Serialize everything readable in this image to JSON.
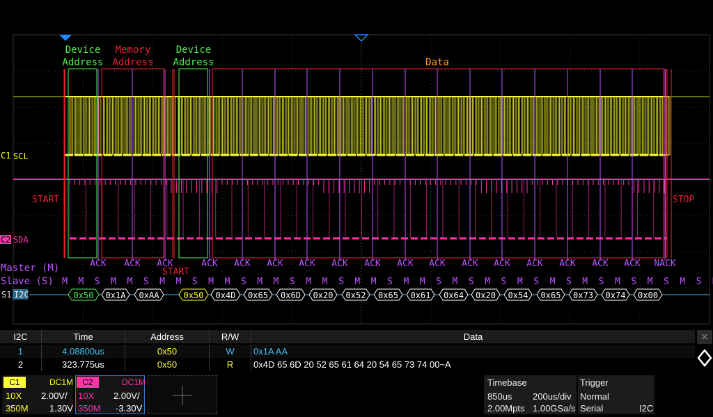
{
  "colors": {
    "ch1": "#ffff33",
    "ch2": "#ff33aa",
    "green": "#55ee55",
    "red": "#ee2233",
    "orange": "#ff9922",
    "purple": "#bb55ff",
    "bus": "#44bbee"
  },
  "scope": {
    "labels": {
      "device_address_1": [
        "Device",
        "Address"
      ],
      "memory_address": [
        "Memory",
        "Address"
      ],
      "device_address_2": [
        "Device",
        "Address"
      ],
      "data": "Data",
      "start": "START",
      "start2": "START",
      "stop": "STOP",
      "master": "Master (M)",
      "slave": "Slave (S)",
      "ch1": "C1",
      "ch1_name": "SCL",
      "ch2": "C2",
      "ch2_name": "SDA",
      "bus_id": "S1",
      "bus_name": "I2C"
    },
    "acks": [
      "ACK",
      "ACK",
      "ACK",
      "ACK",
      "ACK",
      "ACK",
      "ACK",
      "ACK",
      "ACK",
      "ACK",
      "ACK",
      "ACK",
      "ACK",
      "ACK",
      "ACK",
      "ACK",
      "ACK",
      "NACK"
    ],
    "ms_row": [
      "M",
      "M",
      "S",
      "M",
      "M",
      "S",
      "M",
      "M",
      "S",
      "M",
      "M",
      "S",
      "M",
      "M",
      "S",
      "M",
      "M",
      "S",
      "M",
      "M",
      "S",
      "M",
      "M",
      "S",
      "M",
      "S",
      "M",
      "S",
      "M",
      "S",
      "M",
      "S",
      "M",
      "S",
      "M",
      "S",
      "M",
      "S",
      "M",
      "S",
      "M",
      "S",
      "M",
      "S",
      "M",
      "S",
      "M",
      "S",
      "MM"
    ],
    "bytes": [
      "0x50",
      "0x1A",
      "0xAA",
      "0x50",
      "0x4D",
      "0x65",
      "0x6D",
      "0x20",
      "0x52",
      "0x65",
      "0x61",
      "0x64",
      "0x20",
      "0x54",
      "0x65",
      "0x73",
      "0x74",
      "0x00"
    ]
  },
  "table": {
    "headers": [
      "I2C",
      "Time",
      "Address",
      "R/W",
      "Data"
    ],
    "rows": [
      {
        "index": "1",
        "time": "4.08800us",
        "address": "0x50",
        "rw": "W",
        "data": "0x1A AA"
      },
      {
        "index": "2",
        "time": "323.775us",
        "address": "0x50",
        "rw": "R",
        "data": "0x4D 65 6D 20 52 65 61 64 20 54 65 73 74 00~A"
      }
    ],
    "close_icon": "close-icon",
    "nav_icon": "diamond-nav-icon"
  },
  "channels": {
    "c1": {
      "label": "C1",
      "coupling": "DC1M",
      "probe": "10X",
      "scale": "2.00V/",
      "bandwidth": "350M",
      "offset": "1.30V"
    },
    "c2": {
      "label": "C2",
      "coupling": "DC1M",
      "probe": "10X",
      "scale": "2.00V/",
      "bandwidth": "350M",
      "offset": "-3.30V"
    }
  },
  "timebase": {
    "title": "Timebase",
    "delay": "850us",
    "scale": "200us/div",
    "memory": "2.00Mpts",
    "rate": "1.00GSa/s"
  },
  "trigger": {
    "title": "Trigger",
    "mode": "Normal",
    "type": "Serial",
    "source": "I2C"
  }
}
